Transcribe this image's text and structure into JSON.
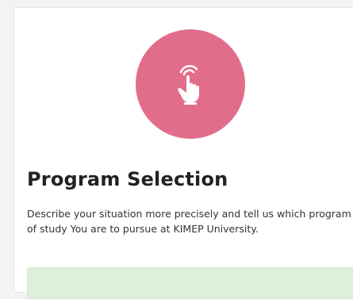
{
  "card": {
    "icon": "hand-pointer-icon",
    "icon_bg_color": "#e26d8b",
    "title": "Program Selection",
    "description": "Describe your situation more precisely and tell us which program of study You are to pursue at KIMEP University."
  },
  "colors": {
    "accent": "#e26d8b",
    "success_bg": "#dff0d8"
  }
}
